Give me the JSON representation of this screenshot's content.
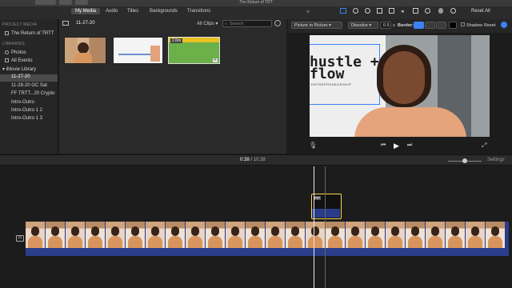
{
  "window": {
    "title": "The Return of TRT"
  },
  "tabs": [
    {
      "label": "My Media",
      "active": true
    },
    {
      "label": "Audio",
      "active": false
    },
    {
      "label": "Titles",
      "active": false
    },
    {
      "label": "Backgrounds",
      "active": false
    },
    {
      "label": "Transitions",
      "active": false
    }
  ],
  "sidebar": {
    "project_header": "PROJECT MEDIA",
    "project_name": "The Return of TRTT",
    "libraries_header": "LIBRARIES",
    "items": [
      {
        "label": "Photos"
      },
      {
        "label": "All Events"
      },
      {
        "label": "iMovie Library"
      },
      {
        "label": "11-27-20",
        "selected": true
      },
      {
        "label": "11-28-20 GC Sat"
      },
      {
        "label": "FF TRTT...20 Crypto"
      },
      {
        "label": "Intro-Outro"
      },
      {
        "label": "Intro-Outro 1 2"
      },
      {
        "label": "Intro-Outro 1 3"
      }
    ]
  },
  "media": {
    "event_title": "11-27-20",
    "filter": "All Clips",
    "search_placeholder": "Search",
    "clip_badge": "2.6m"
  },
  "viewer": {
    "reset_all": "Reset All",
    "pip_mode": "Picture in Picture",
    "transition": "Dissolve",
    "duration": "0.5",
    "duration_unit": "s",
    "border_label": "Border:",
    "shadow_label": "Shadow",
    "reset_label": "Reset",
    "overlay_line1": "hustle +",
    "overlay_line2": "flow",
    "overlay_sub": "ENTREPRENEURSHIP"
  },
  "timeline": {
    "current_time": "0:38",
    "separator": "/",
    "total_time": "10:38",
    "settings_label": "Settings",
    "pip_label": "PIP"
  },
  "colors": {
    "accent": "#3b82f6",
    "selection": "#ffd84a",
    "track": "#2a3d8a"
  }
}
